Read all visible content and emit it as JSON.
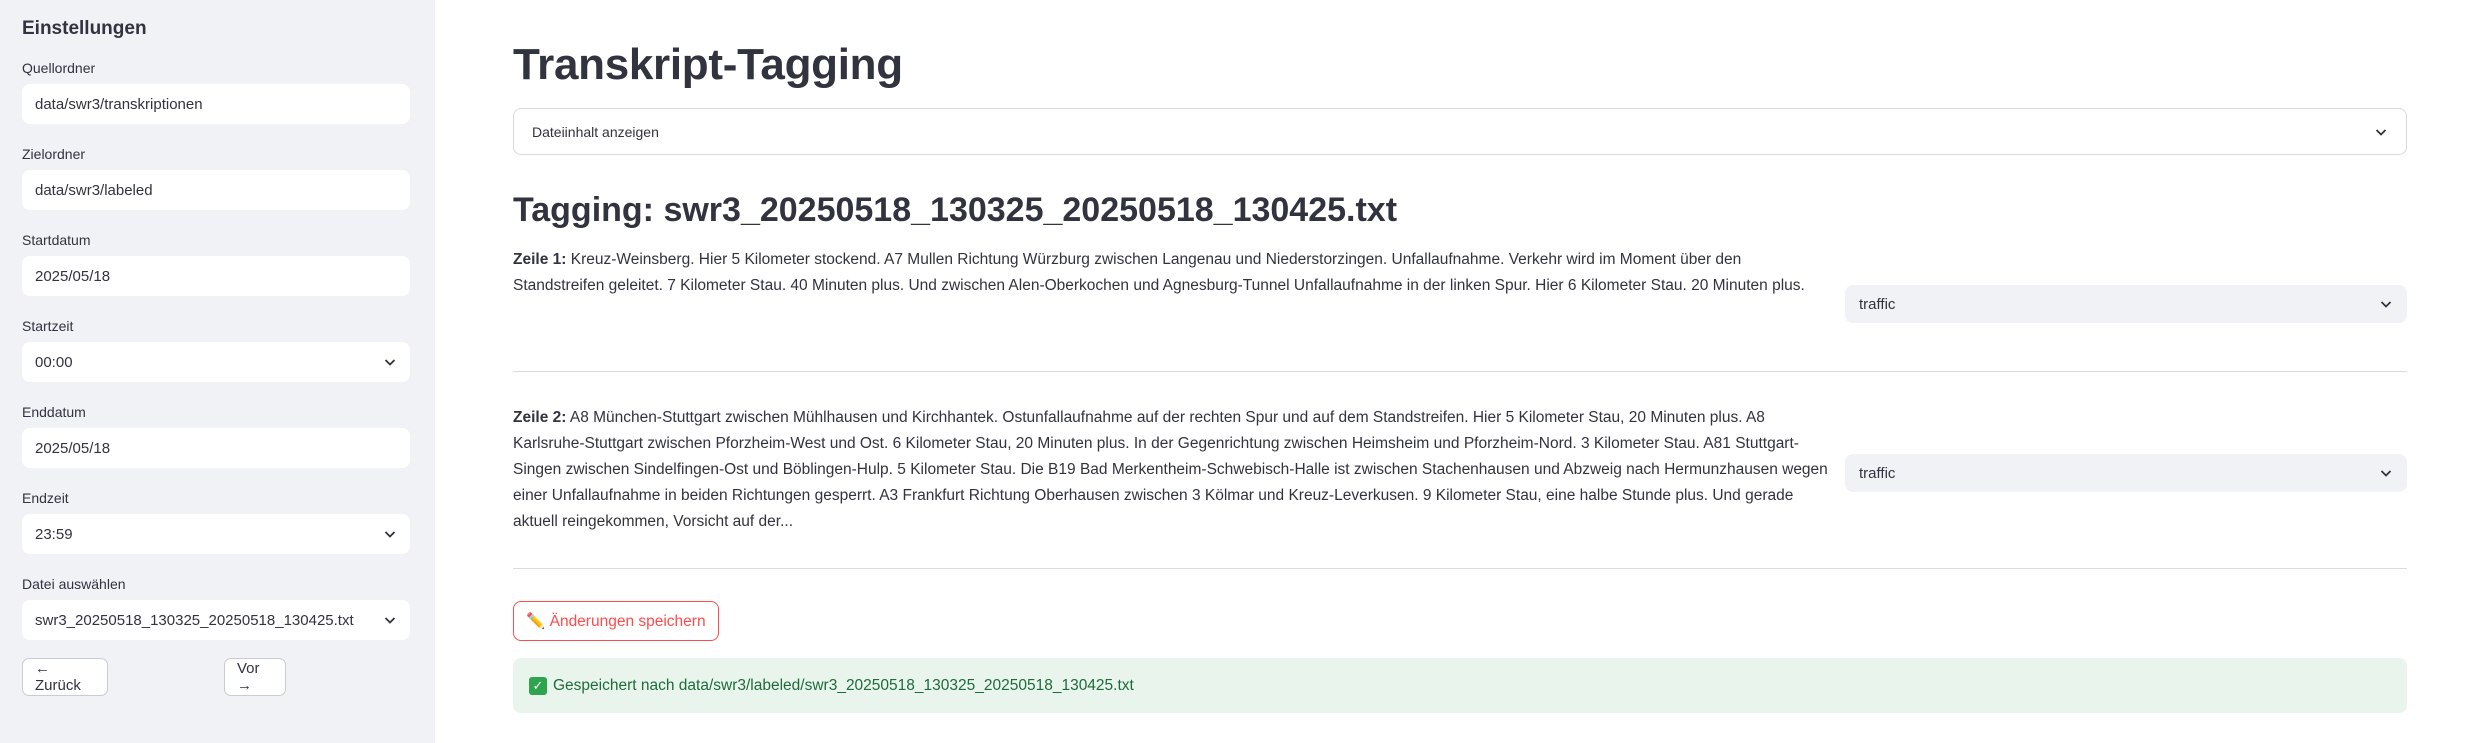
{
  "sidebar": {
    "title": "Einstellungen",
    "source_folder": {
      "label": "Quellordner",
      "value": "data/swr3/transkriptionen"
    },
    "target_folder": {
      "label": "Zielordner",
      "value": "data/swr3/labeled"
    },
    "start_date": {
      "label": "Startdatum",
      "value": "2025/05/18"
    },
    "start_time": {
      "label": "Startzeit",
      "value": "00:00"
    },
    "end_date": {
      "label": "Enddatum",
      "value": "2025/05/18"
    },
    "end_time": {
      "label": "Endzeit",
      "value": "23:59"
    },
    "file_select": {
      "label": "Datei auswählen",
      "value": "swr3_20250518_130325_20250518_130425.txt"
    },
    "back_button": "← Zurück",
    "next_button": "Vor →"
  },
  "main": {
    "title": "Transkript-Tagging",
    "expander_label": "Dateiinhalt anzeigen",
    "tagging_title": "Tagging: swr3_20250518_130325_20250518_130425.txt",
    "lines": [
      {
        "prefix": "Zeile 1:",
        "text": "Kreuz-Weinsberg. Hier 5 Kilometer stockend. A7 Mullen Richtung Würzburg zwischen Langenau und Niederstorzingen. Unfallaufnahme. Verkehr wird im Moment über den Standstreifen geleitet. 7 Kilometer Stau. 40 Minuten plus. Und zwischen Alen-Oberkochen und Agnesburg-Tunnel Unfallaufnahme in der linken Spur. Hier 6 Kilometer Stau. 20 Minuten plus.",
        "tag": "traffic"
      },
      {
        "prefix": "Zeile 2:",
        "text": "A8 München-Stuttgart zwischen Mühlhausen und Kirchhantek. Ostunfallaufnahme auf der rechten Spur und auf dem Standstreifen. Hier 5 Kilometer Stau, 20 Minuten plus. A8 Karlsruhe-Stuttgart zwischen Pforzheim-West und Ost. 6 Kilometer Stau, 20 Minuten plus. In der Gegenrichtung zwischen Heimsheim und Pforzheim-Nord. 3 Kilometer Stau. A81 Stuttgart-Singen zwischen Sindelfingen-Ost und Böblingen-Hulp. 5 Kilometer Stau. Die B19 Bad Merkentheim-Schwebisch-Halle ist zwischen Stachenhausen und Abzweig nach Hermunzhausen wegen einer Unfallaufnahme in beiden Richtungen gesperrt. A3 Frankfurt Richtung Oberhausen zwischen 3 Kölmar und Kreuz-Leverkusen. 9 Kilometer Stau, eine halbe Stunde plus. Und gerade aktuell reingekommen, Vorsicht auf der...",
        "tag": "traffic"
      }
    ],
    "save_button": "✏️ Änderungen speichern",
    "success_message": "Gespeichert nach data/swr3/labeled/swr3_20250518_130325_20250518_130425.txt",
    "success_icon": "check-icon"
  }
}
